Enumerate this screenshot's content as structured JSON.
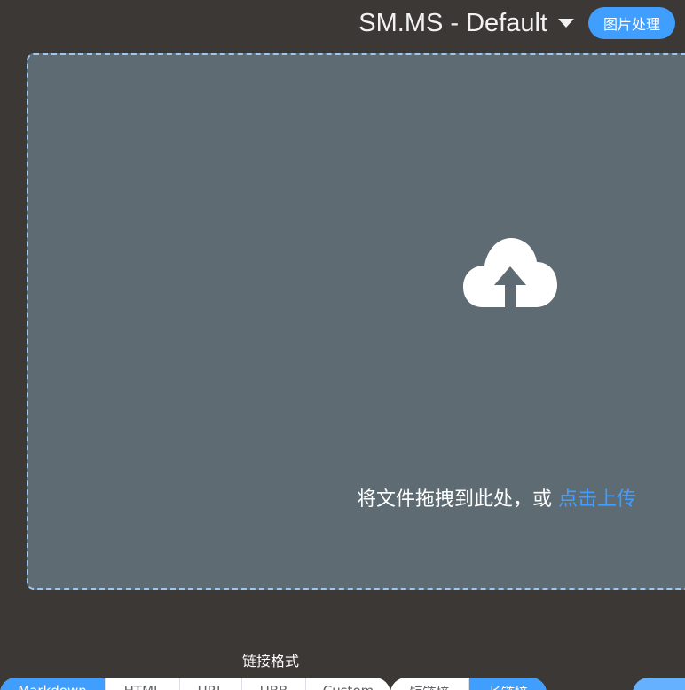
{
  "header": {
    "picbed_title": "SM.MS - Default",
    "image_process_label": "图片处理"
  },
  "upload": {
    "drop_text": "将文件拖拽到此处，或",
    "click_upload": "点击上传"
  },
  "link_format": {
    "label": "链接格式",
    "options": [
      "Markdown",
      "HTML",
      "URL",
      "UBB",
      "Custom"
    ],
    "selected": "Markdown"
  },
  "link_length": {
    "options": [
      "短链接",
      "长链接"
    ],
    "selected": "长链接"
  },
  "colors": {
    "background": "#3c3835",
    "upload_area": "#5e6b72",
    "accent": "#409eff",
    "border_dashed": "#9ec8f0"
  },
  "icons": {
    "upload": "cloud-upload-icon",
    "picbed_dropdown": "caret-down-icon"
  }
}
